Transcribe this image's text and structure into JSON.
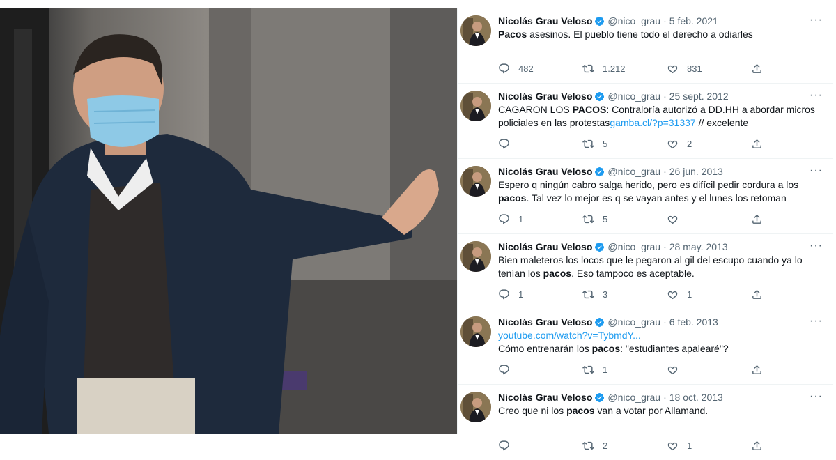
{
  "colors": {
    "link": "#1d9bf0",
    "text": "#0f1419",
    "muted": "#536471",
    "verified": "#1d9bf0"
  },
  "photo": {
    "subject_icon": "person-photo"
  },
  "tweets": [
    {
      "name": "Nicolás Grau Veloso",
      "handle": "@nico_grau",
      "dot": "·",
      "date": "5 feb. 2021",
      "text_parts": [
        {
          "b": "Pacos"
        },
        {
          "t": " asesinos. El pueblo tiene todo el derecho a odiarles"
        }
      ],
      "replies": "482",
      "retweets": "1.212",
      "likes": "831"
    },
    {
      "name": "Nicolás Grau Veloso",
      "handle": "@nico_grau",
      "dot": "·",
      "date": "25 sept. 2012",
      "text_parts": [
        {
          "t": "CAGARON LOS "
        },
        {
          "b": "PACOS"
        },
        {
          "t": ": Contraloría autorizó a DD.HH a abordar micros policiales en las protestas"
        },
        {
          "l": "gamba.cl/?p=31337"
        },
        {
          "t": " // excelente"
        }
      ],
      "replies": "",
      "retweets": "5",
      "likes": "2"
    },
    {
      "name": "Nicolás Grau Veloso",
      "handle": "@nico_grau",
      "dot": "·",
      "date": "26 jun. 2013",
      "text_parts": [
        {
          "t": "Espero q ningún cabro salga herido, pero es difícil pedir cordura a los "
        },
        {
          "b": "pacos"
        },
        {
          "t": ". Tal vez lo mejor es q se vayan antes y el lunes los retoman"
        }
      ],
      "replies": "1",
      "retweets": "5",
      "likes": ""
    },
    {
      "name": "Nicolás Grau Veloso",
      "handle": "@nico_grau",
      "dot": "·",
      "date": "28 may. 2013",
      "text_parts": [
        {
          "t": "Bien maleteros los locos que le pegaron al gil del escupo cuando ya lo tenían los "
        },
        {
          "b": "pacos"
        },
        {
          "t": ". Eso tampoco es aceptable."
        }
      ],
      "replies": "1",
      "retweets": "3",
      "likes": "1"
    },
    {
      "name": "Nicolás Grau Veloso",
      "handle": "@nico_grau",
      "dot": "·",
      "date": "6 feb. 2013",
      "text_parts": [
        {
          "l": "youtube.com/watch?v=TybmdY..."
        },
        {
          "br": true
        },
        {
          "t": "Cómo entrenarán los "
        },
        {
          "b": "pacos"
        },
        {
          "t": ": \"estudiantes apalearé\"?"
        }
      ],
      "replies": "",
      "retweets": "1",
      "likes": ""
    },
    {
      "name": "Nicolás Grau Veloso",
      "handle": "@nico_grau",
      "dot": "·",
      "date": "18 oct. 2013",
      "text_parts": [
        {
          "t": "Creo que ni los "
        },
        {
          "b": "pacos"
        },
        {
          "t": " van a votar por Allamand."
        }
      ],
      "replies": "",
      "retweets": "2",
      "likes": "1"
    }
  ],
  "more_label": "···"
}
